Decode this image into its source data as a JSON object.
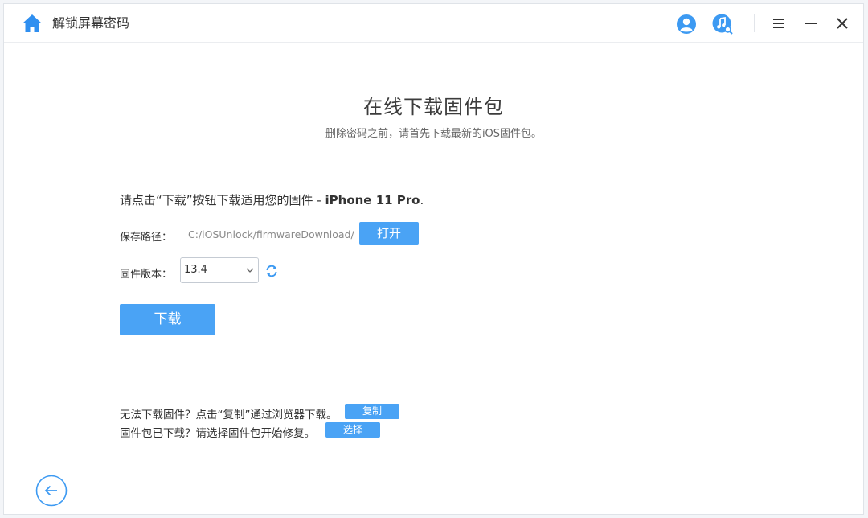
{
  "app": {
    "title": "解锁屏幕密码"
  },
  "header": {
    "title": "在线下载固件包",
    "subtitle": "删除密码之前，请首先下载最新的iOS固件包。"
  },
  "instruction": {
    "prefix": "请点击“下载”按钮下载适用您的固件 - ",
    "device": "iPhone 11 Pro",
    "suffix": "."
  },
  "save_path": {
    "label": "保存路径：",
    "value": "C:/iOSUnlock/firmwareDownload/",
    "open_label": "打开"
  },
  "firmware": {
    "label": "固件版本：",
    "selected": "13.4"
  },
  "download": {
    "label": "下载"
  },
  "footer": {
    "copy_text": "无法下载固件？点击“复制”通过浏览器下载。",
    "copy_label": "复制",
    "select_text": "固件包已下载？请选择固件包开始修复。",
    "select_label": "选择"
  },
  "icons": {
    "home": "home-icon",
    "account": "account-icon",
    "music_search": "music-search-icon",
    "menu": "menu-icon",
    "minimize": "minimize-icon",
    "close": "close-icon",
    "refresh": "refresh-icon",
    "back": "back-arrow-icon"
  },
  "colors": {
    "accent": "#4aa3f5",
    "home": "#2f8ff0"
  }
}
